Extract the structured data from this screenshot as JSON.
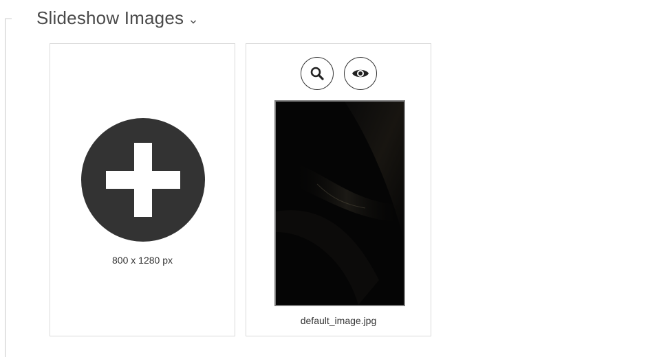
{
  "section": {
    "title": "Slideshow Images"
  },
  "add_card": {
    "resolution": "800 x 1280 px"
  },
  "image_card": {
    "filename": "default_image.jpg"
  },
  "icons": {
    "expand": "chevron-down-icon",
    "add": "plus-circle-icon",
    "zoom": "search-icon",
    "preview": "eye-icon"
  },
  "colors": {
    "add_button": "#333333",
    "thumbnail_background": "#050505"
  }
}
